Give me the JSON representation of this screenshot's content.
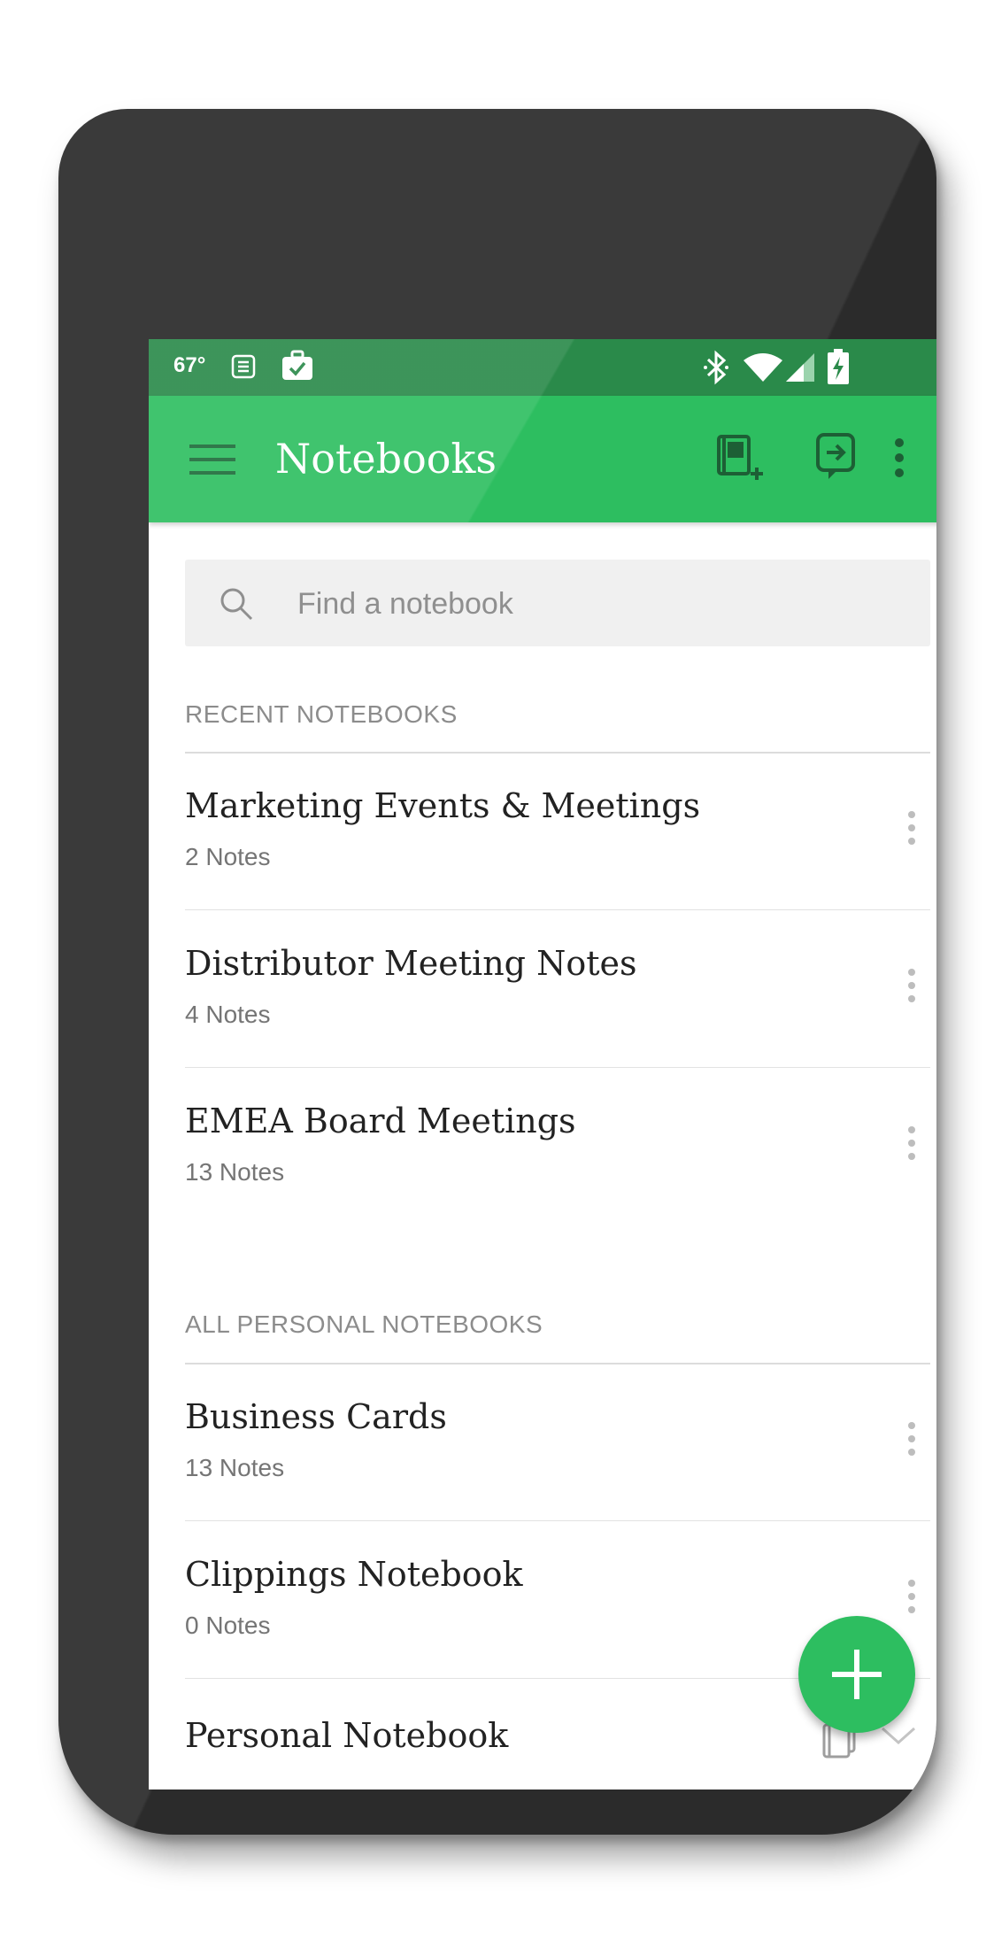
{
  "status_bar": {
    "temperature": "67°",
    "icons": [
      "notes-icon",
      "briefcase-check-icon",
      "bluetooth-icon",
      "wifi-icon",
      "signal-icon",
      "battery-charging-icon"
    ]
  },
  "app_bar": {
    "menu_icon": "hamburger-menu-icon",
    "title": "Notebooks",
    "actions": [
      "new-notebook-icon",
      "sync-icon",
      "more-vertical-icon"
    ]
  },
  "search": {
    "placeholder": "Find a notebook",
    "icon": "search-icon"
  },
  "sections": [
    {
      "heading": "RECENT NOTEBOOKS",
      "notebooks": [
        {
          "name": "Marketing Events & Meetings",
          "count": "2 Notes"
        },
        {
          "name": "Distributor Meeting Notes",
          "count": "4 Notes"
        },
        {
          "name": "EMEA Board Meetings",
          "count": "13 Notes"
        }
      ]
    },
    {
      "heading": "ALL PERSONAL NOTEBOOKS",
      "notebooks": [
        {
          "name": "Business Cards",
          "count": "13 Notes"
        },
        {
          "name": "Clippings Notebook",
          "count": "0 Notes"
        },
        {
          "name": "Personal Notebook",
          "count": ""
        }
      ]
    }
  ],
  "fab": {
    "icon": "plus-icon"
  },
  "colors": {
    "accent": "#2dbe60",
    "status_bar": "#2a8a4a",
    "phone_body": "#2b2b2b"
  }
}
